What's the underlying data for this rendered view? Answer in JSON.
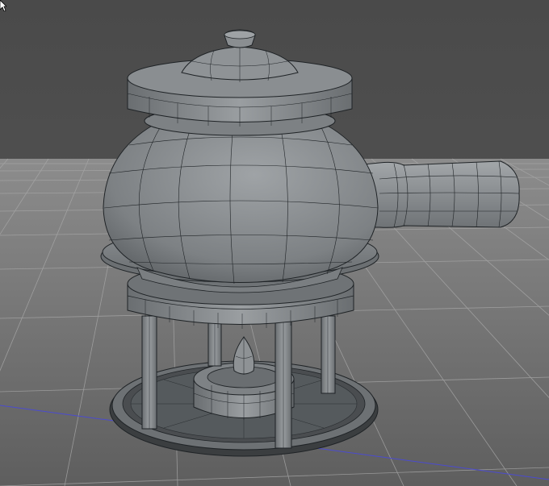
{
  "viewport": {
    "kind": "3d-perspective-viewport",
    "shading": "gouraud-lines",
    "background_color": "#4f4f4f",
    "floor_color": "#6b6b6b",
    "grid_line_color": "#a3a3a3",
    "axis_color": "#4b4bd0",
    "model_color": "#8a8d90",
    "wire_color": "#1f2326"
  },
  "scene": {
    "object": "teapot-on-warmer-stand",
    "parts": [
      "lid",
      "lid-knob",
      "lid-rim",
      "pot-body",
      "handle",
      "pot-base-ring",
      "stand-band",
      "stand-legs",
      "tealight-burner",
      "burner-flame",
      "stand-tray"
    ]
  },
  "cursor": {
    "icon": "resize-arrow-icon"
  }
}
